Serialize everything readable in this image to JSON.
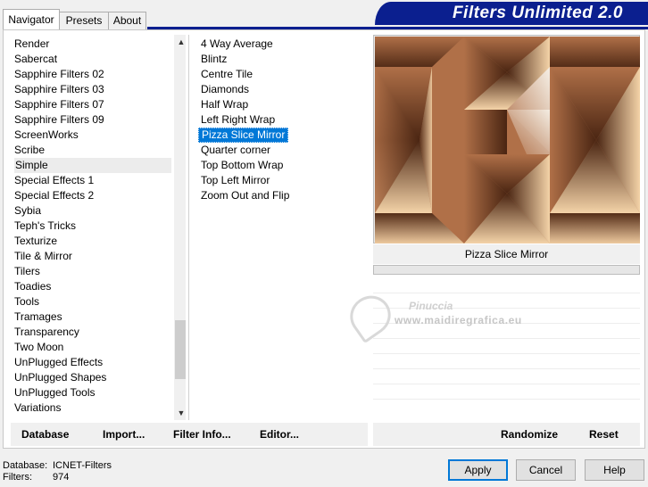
{
  "tabs": [
    {
      "label": "Navigator"
    },
    {
      "label": "Presets"
    },
    {
      "label": "About"
    }
  ],
  "banner": {
    "title": "Filters Unlimited 2.0",
    "color": "#0b1f8f"
  },
  "categories": {
    "items": [
      {
        "label": "Render"
      },
      {
        "label": "Sabercat"
      },
      {
        "label": "Sapphire Filters 02"
      },
      {
        "label": "Sapphire Filters 03"
      },
      {
        "label": "Sapphire Filters 07"
      },
      {
        "label": "Sapphire Filters 09"
      },
      {
        "label": "ScreenWorks"
      },
      {
        "label": "Scribe"
      },
      {
        "label": "Simple"
      },
      {
        "label": "Special Effects 1"
      },
      {
        "label": "Special Effects 2"
      },
      {
        "label": "Sybia"
      },
      {
        "label": "Teph's Tricks"
      },
      {
        "label": "Texturize"
      },
      {
        "label": "Tile & Mirror"
      },
      {
        "label": "Tilers"
      },
      {
        "label": "Toadies"
      },
      {
        "label": "Tools"
      },
      {
        "label": "Tramages"
      },
      {
        "label": "Transparency"
      },
      {
        "label": "Two Moon"
      },
      {
        "label": "UnPlugged Effects"
      },
      {
        "label": "UnPlugged Shapes"
      },
      {
        "label": "UnPlugged Tools"
      },
      {
        "label": "Variations"
      }
    ],
    "selected": "Simple"
  },
  "filters": {
    "items": [
      {
        "label": "4 Way Average"
      },
      {
        "label": "Blintz"
      },
      {
        "label": "Centre Tile"
      },
      {
        "label": "Diamonds"
      },
      {
        "label": "Half Wrap"
      },
      {
        "label": "Left Right Wrap"
      },
      {
        "label": "Pizza Slice Mirror"
      },
      {
        "label": "Quarter corner"
      },
      {
        "label": "Top Bottom Wrap"
      },
      {
        "label": "Top Left Mirror"
      },
      {
        "label": "Zoom Out and Flip"
      }
    ],
    "selected": "Pizza Slice Mirror",
    "selection_color": "#0078d7"
  },
  "preview": {
    "label": "Pizza Slice Mirror",
    "colors": {
      "dark": "#4a2512",
      "mid": "#b07048",
      "light": "#f4d3a8",
      "cream": "#f6f0e6"
    }
  },
  "watermark": {
    "name": "Pinuccia",
    "site": "www.maidiregrafica.eu"
  },
  "left_buttons": {
    "database": "Database",
    "import": "Import...",
    "filter_info": "Filter Info...",
    "editor": "Editor..."
  },
  "right_buttons": {
    "randomize": "Randomize",
    "reset": "Reset"
  },
  "footer": {
    "database_label": "Database:",
    "database_value": "ICNET-Filters",
    "filters_label": "Filters:",
    "filters_value": "974"
  },
  "dialog_buttons": {
    "apply": "Apply",
    "cancel": "Cancel",
    "help": "Help"
  }
}
